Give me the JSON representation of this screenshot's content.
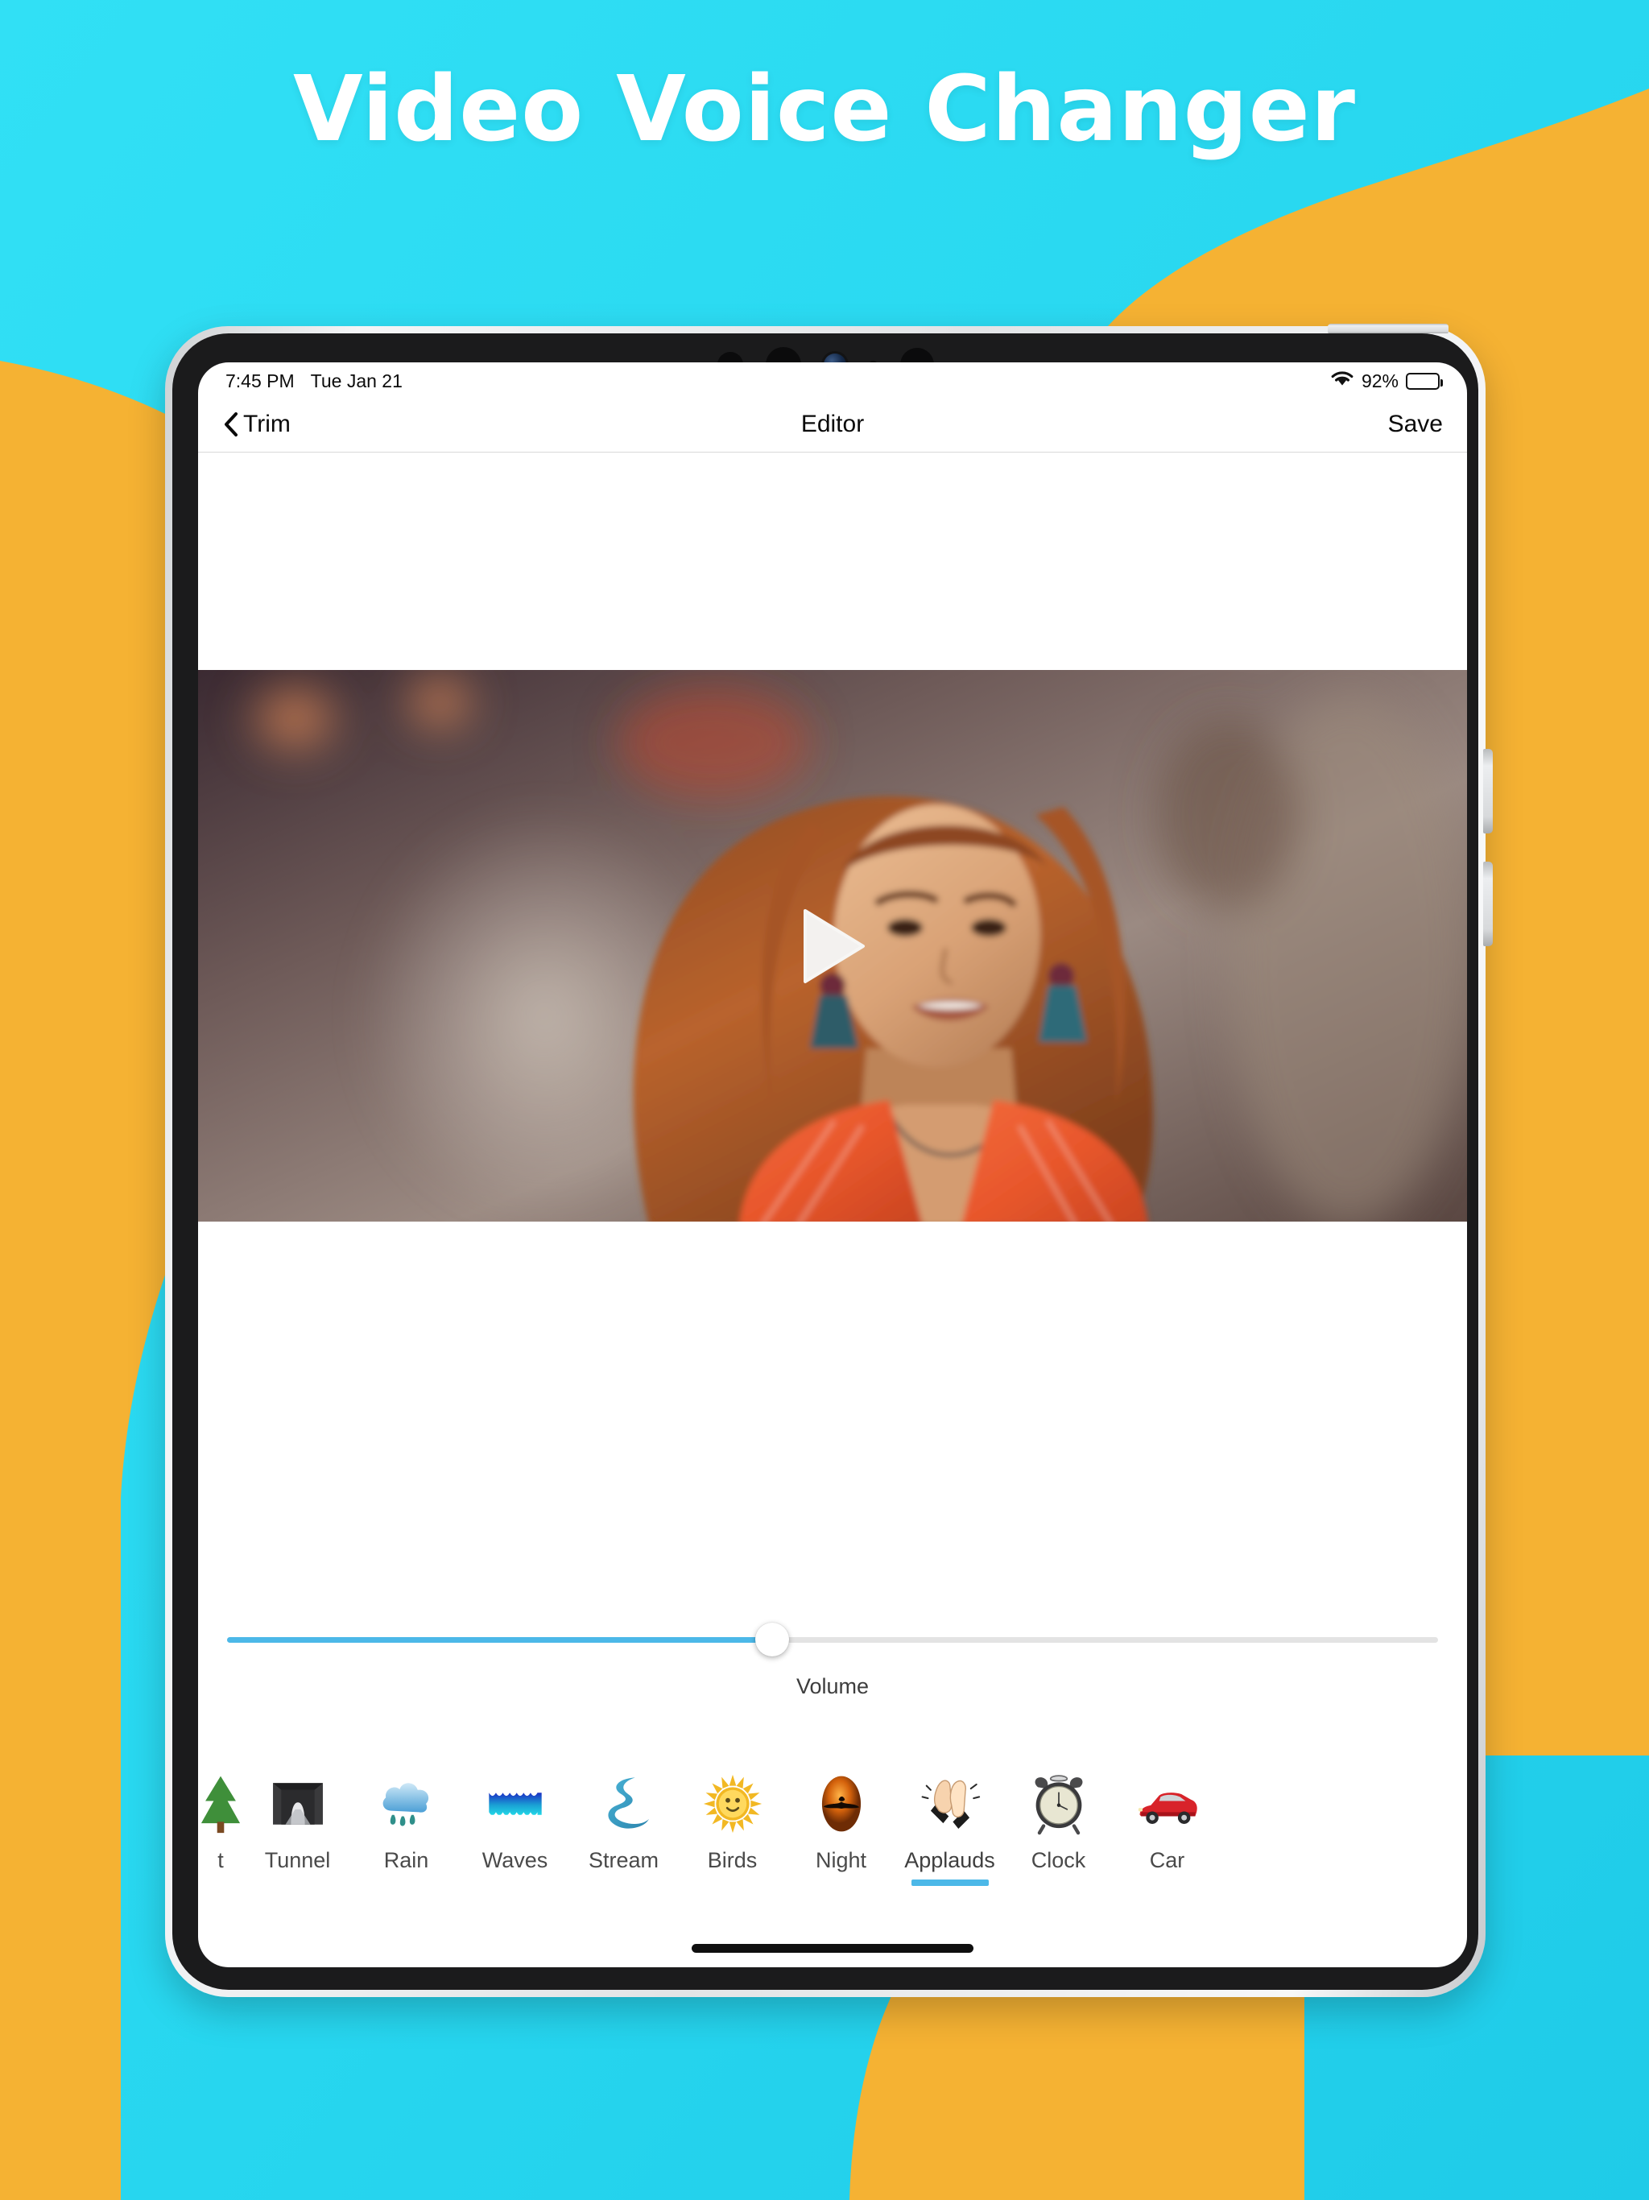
{
  "hero": {
    "title": "Video Voice Changer",
    "background_color": "#2ad9f0",
    "accent_color": "#f5b233"
  },
  "status_bar": {
    "time": "7:45 PM",
    "date": "Tue Jan 21",
    "wifi_icon": "wifi-icon",
    "battery_percent": "92%",
    "battery_level": 92
  },
  "nav_bar": {
    "back_icon": "chevron-left-icon",
    "back_label": "Trim",
    "title": "Editor",
    "save_label": "Save"
  },
  "player": {
    "play_icon": "play-icon",
    "state": "paused"
  },
  "volume": {
    "label": "Volume",
    "value": 45,
    "min": 0,
    "max": 100,
    "fill_color": "#4cb8e8",
    "track_color": "#e3e3e3"
  },
  "sounds": {
    "selected": "Applauds",
    "selected_color": "#4cb8e8",
    "items": [
      {
        "label": "t",
        "icon": "forest-icon",
        "partial": true,
        "selected": false
      },
      {
        "label": "Tunnel",
        "icon": "tunnel-icon",
        "partial": false,
        "selected": false
      },
      {
        "label": "Rain",
        "icon": "rain-cloud-icon",
        "partial": false,
        "selected": false
      },
      {
        "label": "Waves",
        "icon": "waves-icon",
        "partial": false,
        "selected": false
      },
      {
        "label": "Stream",
        "icon": "stream-icon",
        "partial": false,
        "selected": false
      },
      {
        "label": "Birds",
        "icon": "sun-icon",
        "partial": false,
        "selected": false
      },
      {
        "label": "Night",
        "icon": "night-bird-icon",
        "partial": false,
        "selected": false
      },
      {
        "label": "Applauds",
        "icon": "clapping-hands-icon",
        "partial": false,
        "selected": true
      },
      {
        "label": "Clock",
        "icon": "alarm-clock-icon",
        "partial": false,
        "selected": false
      },
      {
        "label": "Car",
        "icon": "car-icon",
        "partial": false,
        "selected": false
      }
    ]
  },
  "device": {
    "power_button": "power-button",
    "volume_up_button": "volume-up-button",
    "volume_down_button": "volume-down-button",
    "home_indicator": "home-indicator"
  }
}
